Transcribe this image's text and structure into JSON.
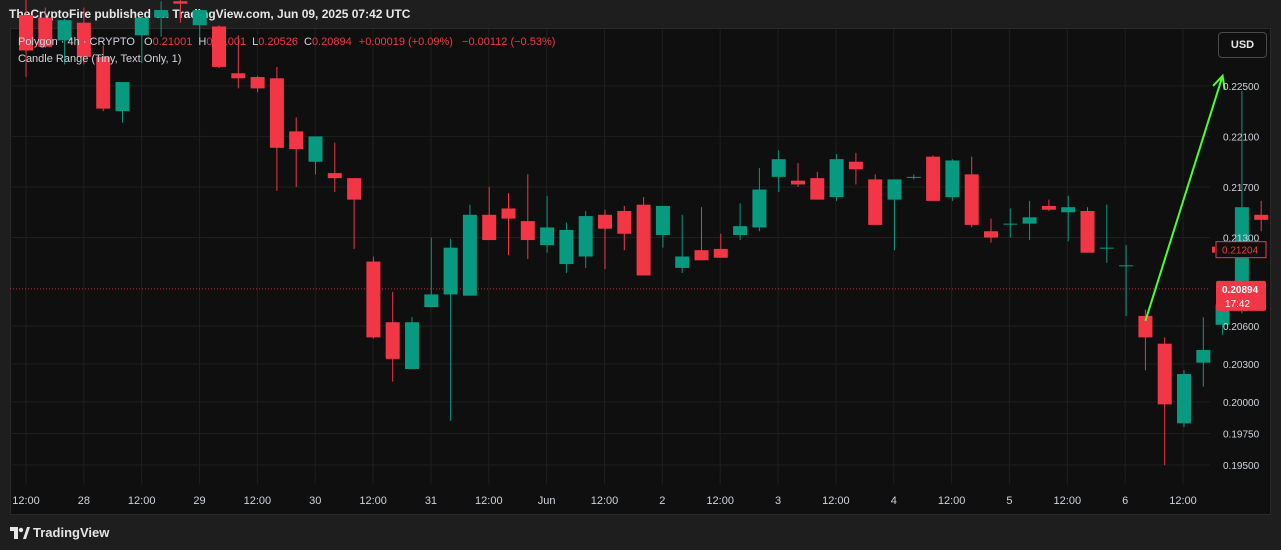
{
  "header": {
    "published": "TheCryptoFire published on TradingView.com, Jun 09, 2025 07:42 UTC"
  },
  "legend": {
    "symbol": "Polygon · 4h · CRYPTO",
    "ohlc": [
      {
        "k": "O",
        "v": "0.21001"
      },
      {
        "k": "H",
        "v": "0.21001"
      },
      {
        "k": "L",
        "v": "0.20526"
      },
      {
        "k": "C",
        "v": "0.20894"
      }
    ],
    "change": "+0.00019 (+0.09%)",
    "change2": "−0.00112 (−0.53%)",
    "indicator": "Candle Range (Tiny, Text Only, 1)"
  },
  "currency_button": "USD",
  "footer": {
    "brand": "TradingView"
  },
  "colors": {
    "up": "#089981",
    "down": "#f23645",
    "arrow": "#4cff2a",
    "grid": "#1e1e1e",
    "bg": "#0f0f0f"
  },
  "chart_data": {
    "type": "candlestick",
    "ylim": [
      0.1935,
      0.2295
    ],
    "y_ticks": [
      0.195,
      0.1975,
      0.2,
      0.203,
      0.206,
      0.213,
      0.217,
      0.221,
      0.225
    ],
    "y_tick_labels": [
      "0.19500",
      "0.19750",
      "0.20000",
      "0.20300",
      "0.20600",
      "0.21300",
      "0.21700",
      "0.22100",
      "0.22500"
    ],
    "x_labels": [
      "12:00",
      "28",
      "12:00",
      "29",
      "12:00",
      "30",
      "12:00",
      "31",
      "12:00",
      "Jun",
      "12:00",
      "2",
      "12:00",
      "3",
      "12:00",
      "4",
      "12:00",
      "5",
      "12:00",
      "6",
      "12:00"
    ],
    "candles": [
      {
        "o": 0.2306,
        "h": 0.2318,
        "l": 0.2257,
        "c": 0.2278
      },
      {
        "o": 0.2304,
        "h": 0.2312,
        "l": 0.228,
        "c": 0.2281
      },
      {
        "o": 0.2286,
        "h": 0.2303,
        "l": 0.2267,
        "c": 0.2302
      },
      {
        "o": 0.23,
        "h": 0.2312,
        "l": 0.2267,
        "c": 0.2273
      },
      {
        "o": 0.2273,
        "h": 0.2282,
        "l": 0.223,
        "c": 0.2232
      },
      {
        "o": 0.223,
        "h": 0.225,
        "l": 0.2221,
        "c": 0.2253
      },
      {
        "o": 0.229,
        "h": 0.2305,
        "l": 0.2268,
        "c": 0.2304
      },
      {
        "o": 0.2304,
        "h": 0.2317,
        "l": 0.2289,
        "c": 0.231
      },
      {
        "o": 0.2317,
        "h": 0.2318,
        "l": 0.23,
        "c": 0.2315
      },
      {
        "o": 0.2298,
        "h": 0.23,
        "l": 0.2287,
        "c": 0.231
      },
      {
        "o": 0.2297,
        "h": 0.2298,
        "l": 0.2264,
        "c": 0.2265
      },
      {
        "o": 0.226,
        "h": 0.229,
        "l": 0.2248,
        "c": 0.2256
      },
      {
        "o": 0.2257,
        "h": 0.2258,
        "l": 0.2245,
        "c": 0.2248
      },
      {
        "o": 0.2256,
        "h": 0.2265,
        "l": 0.2167,
        "c": 0.2201
      },
      {
        "o": 0.2214,
        "h": 0.2225,
        "l": 0.217,
        "c": 0.22
      },
      {
        "o": 0.219,
        "h": 0.2209,
        "l": 0.218,
        "c": 0.221
      },
      {
        "o": 0.2181,
        "h": 0.2205,
        "l": 0.2166,
        "c": 0.2177
      },
      {
        "o": 0.2177,
        "h": 0.2165,
        "l": 0.2121,
        "c": 0.216
      },
      {
        "o": 0.2111,
        "h": 0.2115,
        "l": 0.205,
        "c": 0.2051
      },
      {
        "o": 0.2063,
        "h": 0.2087,
        "l": 0.2016,
        "c": 0.2034
      },
      {
        "o": 0.2026,
        "h": 0.2067,
        "l": 0.2026,
        "c": 0.2063
      },
      {
        "o": 0.2075,
        "h": 0.213,
        "l": 0.2076,
        "c": 0.2085
      },
      {
        "o": 0.2085,
        "h": 0.2129,
        "l": 0.1985,
        "c": 0.2122
      },
      {
        "o": 0.2084,
        "h": 0.2156,
        "l": 0.2084,
        "c": 0.2148
      },
      {
        "o": 0.2148,
        "h": 0.217,
        "l": 0.2128,
        "c": 0.2128
      },
      {
        "o": 0.2153,
        "h": 0.2165,
        "l": 0.2116,
        "c": 0.2145
      },
      {
        "o": 0.2143,
        "h": 0.218,
        "l": 0.2113,
        "c": 0.2128
      },
      {
        "o": 0.2124,
        "h": 0.2163,
        "l": 0.2118,
        "c": 0.2138
      },
      {
        "o": 0.2109,
        "h": 0.2142,
        "l": 0.2102,
        "c": 0.2136
      },
      {
        "o": 0.2115,
        "h": 0.2151,
        "l": 0.2106,
        "c": 0.2147
      },
      {
        "o": 0.2148,
        "h": 0.2152,
        "l": 0.2105,
        "c": 0.2137
      },
      {
        "o": 0.2151,
        "h": 0.2155,
        "l": 0.212,
        "c": 0.2133
      },
      {
        "o": 0.2156,
        "h": 0.2162,
        "l": 0.2124,
        "c": 0.21
      },
      {
        "o": 0.2132,
        "h": 0.2154,
        "l": 0.2122,
        "c": 0.2155
      },
      {
        "o": 0.2106,
        "h": 0.2148,
        "l": 0.2102,
        "c": 0.2115
      },
      {
        "o": 0.212,
        "h": 0.2154,
        "l": 0.2114,
        "c": 0.2112
      },
      {
        "o": 0.2121,
        "h": 0.2133,
        "l": 0.2118,
        "c": 0.2114
      },
      {
        "o": 0.2132,
        "h": 0.2157,
        "l": 0.2128,
        "c": 0.2139
      },
      {
        "o": 0.2138,
        "h": 0.2185,
        "l": 0.2135,
        "c": 0.2168
      },
      {
        "o": 0.2178,
        "h": 0.2199,
        "l": 0.2166,
        "c": 0.2192
      },
      {
        "o": 0.2175,
        "h": 0.2189,
        "l": 0.217,
        "c": 0.2172
      },
      {
        "o": 0.2177,
        "h": 0.2182,
        "l": 0.2162,
        "c": 0.216
      },
      {
        "o": 0.2162,
        "h": 0.2196,
        "l": 0.2159,
        "c": 0.2192
      },
      {
        "o": 0.219,
        "h": 0.2197,
        "l": 0.2172,
        "c": 0.2184
      },
      {
        "o": 0.2176,
        "h": 0.218,
        "l": 0.2142,
        "c": 0.214
      },
      {
        "o": 0.216,
        "h": 0.2174,
        "l": 0.212,
        "c": 0.2176
      },
      {
        "o": 0.2178,
        "h": 0.218,
        "l": 0.2176,
        "c": 0.2178
      },
      {
        "o": 0.2194,
        "h": 0.2195,
        "l": 0.2159,
        "c": 0.2159
      },
      {
        "o": 0.2162,
        "h": 0.2192,
        "l": 0.2159,
        "c": 0.2191
      },
      {
        "o": 0.218,
        "h": 0.2194,
        "l": 0.2138,
        "c": 0.214
      },
      {
        "o": 0.2135,
        "h": 0.2145,
        "l": 0.2126,
        "c": 0.213
      },
      {
        "o": 0.2141,
        "h": 0.2153,
        "l": 0.213,
        "c": 0.2141
      },
      {
        "o": 0.2141,
        "h": 0.2159,
        "l": 0.2128,
        "c": 0.2146
      },
      {
        "o": 0.2155,
        "h": 0.216,
        "l": 0.2151,
        "c": 0.2152
      },
      {
        "o": 0.215,
        "h": 0.2163,
        "l": 0.2127,
        "c": 0.2154
      },
      {
        "o": 0.2151,
        "h": 0.2154,
        "l": 0.2121,
        "c": 0.2118
      },
      {
        "o": 0.2122,
        "h": 0.2156,
        "l": 0.211,
        "c": 0.2122
      },
      {
        "o": 0.2108,
        "h": 0.2124,
        "l": 0.2068,
        "c": 0.2108
      },
      {
        "o": 0.2068,
        "h": 0.2073,
        "l": 0.2025,
        "c": 0.2051
      },
      {
        "o": 0.2046,
        "h": 0.2051,
        "l": 0.195,
        "c": 0.1998
      },
      {
        "o": 0.1983,
        "h": 0.2025,
        "l": 0.198,
        "c": 0.2022
      },
      {
        "o": 0.2031,
        "h": 0.2067,
        "l": 0.2012,
        "c": 0.2041
      },
      {
        "o": 0.2061,
        "h": 0.2076,
        "l": 0.2053,
        "c": 0.2077
      },
      {
        "o": 0.2077,
        "h": 0.2246,
        "l": 0.207,
        "c": 0.2154
      },
      {
        "o": 0.2148,
        "h": 0.2159,
        "l": 0.2135,
        "c": 0.2144
      }
    ],
    "current_price": {
      "value": 0.20894,
      "label": "0.20894",
      "timer": "17:42"
    },
    "marker_price": {
      "value": 0.21204,
      "label": "0.21204"
    },
    "arrow_annotation": {
      "from": [
        58,
        0.2064
      ],
      "to": [
        62,
        0.2258
      ]
    }
  }
}
